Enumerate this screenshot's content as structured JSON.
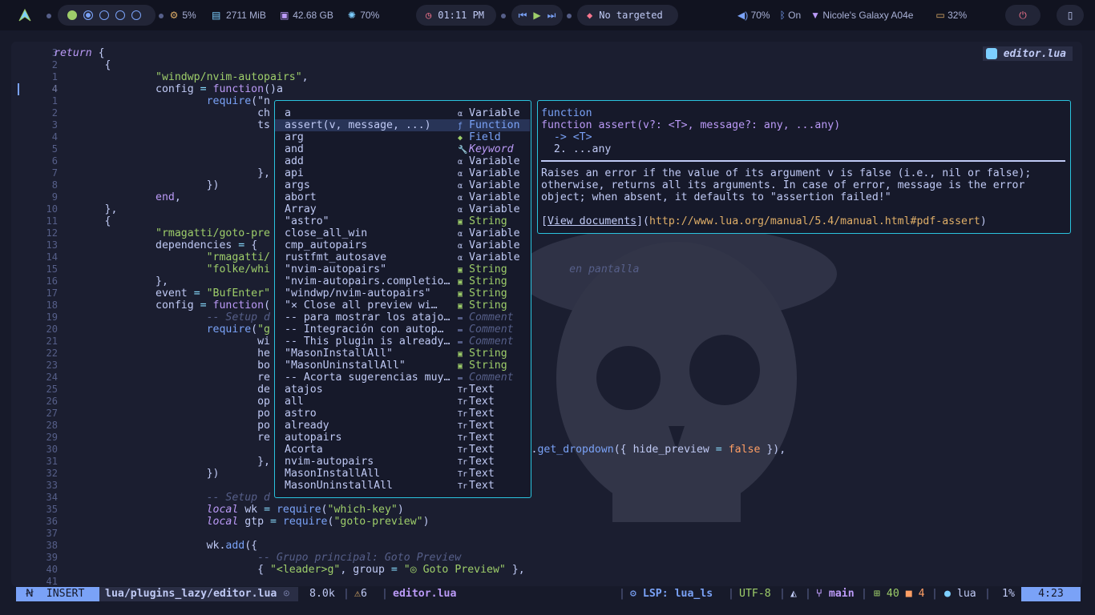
{
  "topbar": {
    "cpu": "5%",
    "memory": "2711 MiB",
    "disk": "42.68 GB",
    "brightness": "70%",
    "clock": "01:11 PM",
    "target": "No targeted",
    "volume": "70%",
    "bluetooth": "On",
    "wifi": "Nicole's Galaxy A04e",
    "battery": "32%"
  },
  "editor": {
    "filename": "editor.lua",
    "lines": [
      {
        "n": "3",
        "html": "<span class='kw'>return</span> <span class='punc'>{</span>"
      },
      {
        "n": "2",
        "html": "        <span class='punc'>{</span>"
      },
      {
        "n": "1",
        "html": "                <span class='str'>\"windwp/nvim-autopairs\"</span><span class='punc'>,</span>"
      },
      {
        "n": "4",
        "cur": true,
        "html": "                <span class='var'>config</span> <span class='op'>=</span> <span class='kw' style='font-style:normal'>function</span><span class='punc'>()</span><span class='var'>a</span>"
      },
      {
        "n": "1",
        "html": "                        <span class='fn'>require</span><span class='punc'>(\"n</span>"
      },
      {
        "n": "2",
        "html": "                                <span class='var'>ch</span>"
      },
      {
        "n": "3",
        "html": "                                <span class='var'>ts</span>"
      },
      {
        "n": "4",
        "html": ""
      },
      {
        "n": "5",
        "html": ""
      },
      {
        "n": "6",
        "html": ""
      },
      {
        "n": "7",
        "html": "                                <span class='punc'>},</span>"
      },
      {
        "n": "8",
        "html": "                        <span class='punc'>})</span>"
      },
      {
        "n": "9",
        "html": "                <span class='kw' style='font-style:normal'>end</span><span class='punc'>,</span>"
      },
      {
        "n": "10",
        "html": "        <span class='punc'>},</span>"
      },
      {
        "n": "11",
        "html": "        <span class='punc'>{</span>"
      },
      {
        "n": "12",
        "html": "                <span class='str'>\"rmagatti/goto-pre</span>"
      },
      {
        "n": "13",
        "html": "                <span class='var'>dependencies</span> <span class='op'>=</span> <span class='punc'>{</span>"
      },
      {
        "n": "14",
        "html": "                        <span class='str'>\"rmagatti/</span>"
      },
      {
        "n": "15",
        "html": "                        <span class='str'>\"folke/whi</span>                                               <span class='cm'>en pantalla</span>"
      },
      {
        "n": "16",
        "html": "                <span class='punc'>},</span>"
      },
      {
        "n": "17",
        "html": "                <span class='var'>event</span> <span class='op'>=</span> <span class='str'>\"BufEnter\"</span>"
      },
      {
        "n": "18",
        "html": "                <span class='var'>config</span> <span class='op'>=</span> <span class='kw' style='font-style:normal'>function</span><span class='punc'>(</span>"
      },
      {
        "n": "19",
        "html": "                        <span class='cm'>-- Setup d</span>"
      },
      {
        "n": "20",
        "html": "                        <span class='fn'>require</span><span class='punc'>(</span><span class='str'>\"g</span>"
      },
      {
        "n": "21",
        "html": "                                <span class='var'>wi</span>"
      },
      {
        "n": "22",
        "html": "                                <span class='var'>he</span>"
      },
      {
        "n": "23",
        "html": "                                <span class='var'>bo</span>"
      },
      {
        "n": "24",
        "html": "                                <span class='var'>re</span>"
      },
      {
        "n": "25",
        "html": "                                <span class='var'>de</span>"
      },
      {
        "n": "26",
        "html": "                                <span class='var'>op</span>"
      },
      {
        "n": "27",
        "html": "                                <span class='var'>po</span>"
      },
      {
        "n": "28",
        "html": "                                <span class='var'>po</span>"
      },
      {
        "n": "29",
        "html": "                                <span class='var'>re</span>"
      },
      {
        "n": "30",
        "html": "                                                                       <span class='str'>es\"</span><span class='punc'>).</span><span class='fn'>get_dropdown</span><span class='punc'>({</span> <span class='var'>hide_preview</span> <span class='op'>=</span> <span class='bool'>false</span> <span class='punc'>}),</span>"
      },
      {
        "n": "31",
        "html": "                                <span class='punc'>},</span>"
      },
      {
        "n": "32",
        "html": "                        <span class='punc'>})</span>"
      },
      {
        "n": "33",
        "html": ""
      },
      {
        "n": "34",
        "html": "                        <span class='cm'>-- Setup d</span>"
      },
      {
        "n": "35",
        "html": "                        <span class='kw'>local</span> <span class='var'>wk</span> <span class='op'>=</span> <span class='fn'>require</span><span class='punc'>(</span><span class='str'>\"which-key\"</span><span class='punc'>)</span>"
      },
      {
        "n": "36",
        "html": "                        <span class='kw'>local</span> <span class='var'>gtp</span> <span class='op'>=</span> <span class='fn'>require</span><span class='punc'>(</span><span class='str'>\"goto-preview\"</span><span class='punc'>)</span>"
      },
      {
        "n": "37",
        "html": ""
      },
      {
        "n": "38",
        "html": "                        <span class='var'>wk</span><span class='punc'>.</span><span class='fn'>add</span><span class='punc'>({</span>"
      },
      {
        "n": "39",
        "html": "                                <span class='cm'>-- Grupo principal: Goto Preview</span>"
      },
      {
        "n": "40",
        "html": "                                <span class='punc'>{</span> <span class='str'>\"&lt;leader&gt;g\"</span><span class='punc'>,</span> <span class='var'>group</span> <span class='op'>=</span> <span class='str'>\"◎ Goto Preview\"</span> <span class='punc'>},</span>"
      },
      {
        "n": "41",
        "html": ""
      }
    ]
  },
  "completion": {
    "items": [
      {
        "label": "a",
        "kind": "Variable",
        "k": "var",
        "icon": "α"
      },
      {
        "label": "assert(v, message, ...)",
        "kind": "Function",
        "k": "fun",
        "icon": "ƒ",
        "selected": true
      },
      {
        "label": "arg",
        "kind": "Field",
        "k": "fld",
        "icon": "◆"
      },
      {
        "label": "and",
        "kind": "Keyword",
        "k": "kw",
        "icon": "🔧"
      },
      {
        "label": "add",
        "kind": "Variable",
        "k": "var",
        "icon": "α"
      },
      {
        "label": "api",
        "kind": "Variable",
        "k": "var",
        "icon": "α"
      },
      {
        "label": "args",
        "kind": "Variable",
        "k": "var",
        "icon": "α"
      },
      {
        "label": "abort",
        "kind": "Variable",
        "k": "var",
        "icon": "α"
      },
      {
        "label": "Array",
        "kind": "Variable",
        "k": "var",
        "icon": "α"
      },
      {
        "label": "\"astro\"",
        "kind": "String",
        "k": "str",
        "icon": "▣"
      },
      {
        "label": "close_all_win",
        "kind": "Variable",
        "k": "var",
        "icon": "α"
      },
      {
        "label": "cmp_autopairs",
        "kind": "Variable",
        "k": "var",
        "icon": "α"
      },
      {
        "label": "rustfmt_autosave",
        "kind": "Variable",
        "k": "var",
        "icon": "α"
      },
      {
        "label": "\"nvim-autopairs\"",
        "kind": "String",
        "k": "str",
        "icon": "▣"
      },
      {
        "label": "\"nvim-autopairs.completio…",
        "kind": "String",
        "k": "str",
        "icon": "▣"
      },
      {
        "label": "\"windwp/nvim-autopairs\"",
        "kind": "String",
        "k": "str",
        "icon": "▣"
      },
      {
        "label": "\"✕ Close all preview wi…",
        "kind": "String",
        "k": "str",
        "icon": "▣"
      },
      {
        "label": "-- para mostrar los atajo…",
        "kind": "Comment",
        "k": "cm",
        "icon": "▬"
      },
      {
        "label": "-- Integración con autop…",
        "kind": "Comment",
        "k": "cm",
        "icon": "▬"
      },
      {
        "label": "-- This plugin is already…",
        "kind": "Comment",
        "k": "cm",
        "icon": "▬"
      },
      {
        "label": "\"MasonInstallAll\"",
        "kind": "String",
        "k": "str",
        "icon": "▣"
      },
      {
        "label": "\"MasonUninstallAll\"",
        "kind": "String",
        "k": "str",
        "icon": "▣"
      },
      {
        "label": "-- Acorta sugerencias muy…",
        "kind": "Comment",
        "k": "cm",
        "icon": "▬"
      },
      {
        "label": "atajos",
        "kind": "Text",
        "k": "txt",
        "icon": "Tr"
      },
      {
        "label": "all",
        "kind": "Text",
        "k": "txt",
        "icon": "Tr"
      },
      {
        "label": "astro",
        "kind": "Text",
        "k": "txt",
        "icon": "Tr"
      },
      {
        "label": "already",
        "kind": "Text",
        "k": "txt",
        "icon": "Tr"
      },
      {
        "label": "autopairs",
        "kind": "Text",
        "k": "txt",
        "icon": "Tr"
      },
      {
        "label": "Acorta",
        "kind": "Text",
        "k": "txt",
        "icon": "Tr"
      },
      {
        "label": "nvim-autopairs",
        "kind": "Text",
        "k": "txt",
        "icon": "Tr"
      },
      {
        "label": "MasonInstallAll",
        "kind": "Text",
        "k": "txt",
        "icon": "Tr"
      },
      {
        "label": "MasonUninstallAll",
        "kind": "Text",
        "k": "txt",
        "icon": "Tr"
      }
    ]
  },
  "docs": {
    "l1": "function",
    "l2": "function assert(v?: <T>, message?: any, ...any)",
    "l3": "  -> <T>",
    "l4": "  2. ...any",
    "l5": "Raises an error if the value of its argument v is false (i.e., nil or false);",
    "l6": "otherwise, returns all its arguments. In case of error, message is the error",
    "l7": "object; when absent, it defaults to \"assertion failed!\"",
    "link_text": "View documents",
    "link_url": "http://www.lua.org/manual/5.4/manual.html#pdf-assert"
  },
  "statusline": {
    "mode": "INSERT",
    "file": "lua/plugins_lazy/editor.lua",
    "size": "8.0k",
    "warnings": "6",
    "filename": "editor.lua",
    "lsp": "LSP: lua_ls",
    "encoding": "UTF-8",
    "branch": "main",
    "added": "40",
    "changed": "4",
    "filetype": "lua",
    "percent": "1%",
    "position": "4:23"
  },
  "colors": {
    "accent": "#7aa2f7",
    "border": "#2ac3de",
    "string": "#9ece6a",
    "keyword": "#bb9af7"
  }
}
